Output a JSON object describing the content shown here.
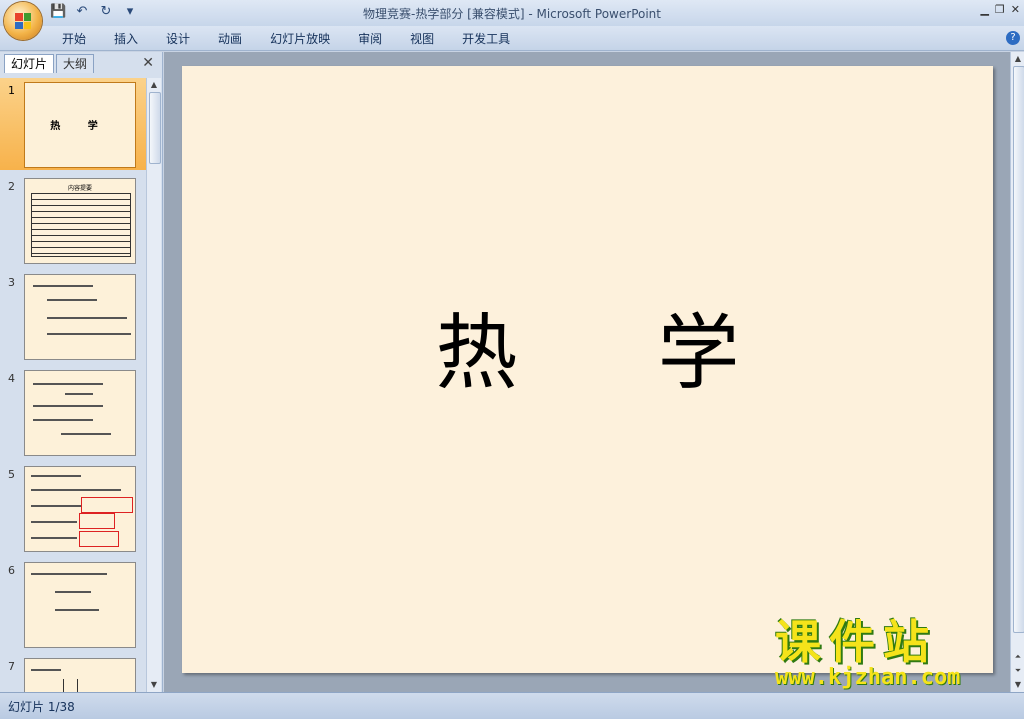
{
  "window": {
    "title": "物理竞赛-热学部分 [兼容模式] - Microsoft PowerPoint"
  },
  "ribbon": {
    "tabs": [
      "开始",
      "插入",
      "设计",
      "动画",
      "幻灯片放映",
      "审阅",
      "视图",
      "开发工具"
    ]
  },
  "pane": {
    "tab_slides": "幻灯片",
    "tab_outline": "大纲"
  },
  "thumbnails": [
    {
      "number": "1",
      "title": "热  学",
      "selected": true
    },
    {
      "number": "2",
      "title": "内容提要"
    },
    {
      "number": "3"
    },
    {
      "number": "4"
    },
    {
      "number": "5"
    },
    {
      "number": "6"
    },
    {
      "number": "7"
    }
  ],
  "slide": {
    "title": "热学"
  },
  "status": {
    "slide_counter": "幻灯片 1/38"
  },
  "watermark": {
    "text": "课件站",
    "url": "www.kjzhan.com"
  },
  "colors": {
    "selected_thumb": "#f7b24b",
    "slide_background": "#fdf1dc",
    "ribbon": "#c5d4e8",
    "watermark_fill": "#f5e31a",
    "watermark_outline": "#2f7a12"
  }
}
